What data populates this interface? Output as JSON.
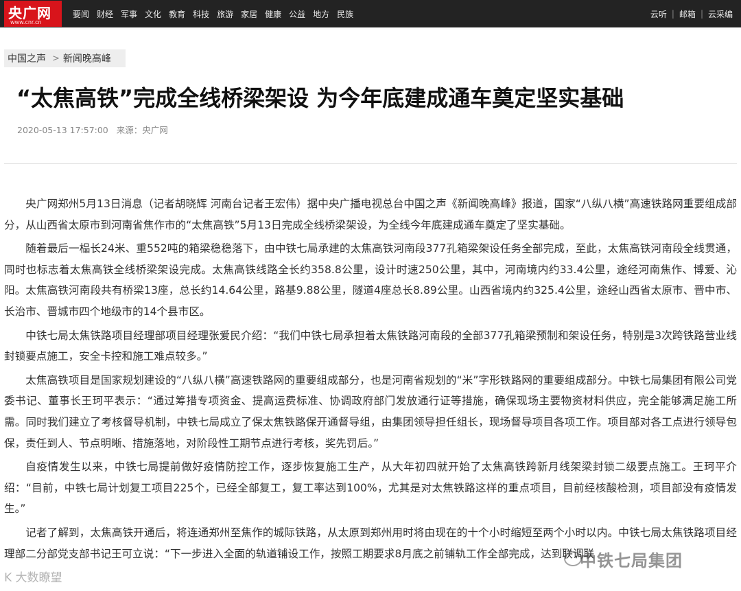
{
  "header": {
    "logo_cn": "央广网",
    "logo_en": "www.cnr.cn",
    "nav": [
      "要闻",
      "财经",
      "军事",
      "文化",
      "教育",
      "科技",
      "旅游",
      "家居",
      "健康",
      "公益",
      "地方",
      "民族"
    ],
    "right_nav": [
      "云听",
      "邮箱",
      "云采编"
    ]
  },
  "breadcrumb": {
    "first": "中国之声",
    "second": "新闻晚高峰"
  },
  "article": {
    "title": "“太焦高铁”完成全线桥梁架设 为今年底建成通车奠定坚实基础",
    "date": "2020-05-13 17:57:00",
    "source": "来源：央广网",
    "paragraphs": [
      "央广网郑州5月13日消息（记者胡晓辉 河南台记者王宏伟）据中央广播电视总台中国之声《新闻晚高峰》报道，国家“八纵八横”高速铁路网重要组成部分，从山西省太原市到河南省焦作市的“太焦高铁”5月13日完成全线桥梁架设，为全线今年底建成通车奠定了坚实基础。",
      "随着最后一榀长24米、重552吨的箱梁稳稳落下，由中铁七局承建的太焦高铁河南段377孔箱梁架设任务全部完成，至此，太焦高铁河南段全线贯通，同时也标志着太焦高铁全线桥梁架设完成。太焦高铁线路全长约358.8公里，设计时速250公里，其中，河南境内约33.4公里，途经河南焦作、博爱、沁阳。太焦高铁河南段共有桥梁13座，总长约14.64公里，路基9.88公里，隧道4座总长8.89公里。山西省境内约325.4公里，途经山西省太原市、晋中市、长治市、晋城市四个地级市的14个县市区。",
      "中铁七局太焦铁路项目经理部项目经理张爱民介绍：“我们中铁七局承担着太焦铁路河南段的全部377孔箱梁预制和架设任务，特别是3次跨铁路营业线封锁要点施工，安全卡控和施工难点较多。”",
      "太焦高铁项目是国家规划建设的“八纵八横”高速铁路网的重要组成部分，也是河南省规划的“米”字形铁路网的重要组成部分。中铁七局集团有限公司党委书记、董事长王珂平表示：“通过筹措专项资金、提高运费标准、协调政府部门发放通行证等措施，确保现场主要物资材料供应，完全能够满足施工所需。同时我们建立了考核督导机制，中铁七局成立了保太焦铁路保开通督导组，由集团领导担任组长，现场督导项目各项工作。项目部对各工点进行领导包保，责任到人、节点明晰、措施落地，对阶段性工期节点进行考核，奖先罚后。”",
      "自疫情发生以来，中铁七局提前做好疫情防控工作，逐步恢复施工生产，从大年初四就开始了太焦高铁跨新月线架梁封锁二级要点施工。王珂平介绍：“目前，中铁七局计划复工项目225个，已经全部复工，复工率达到100%，尤其是对太焦铁路这样的重点项目，目前经核酸检测，项目部没有疫情发生。”",
      "记者了解到，太焦高铁开通后，将连通郑州至焦作的城际铁路，从太原到郑州用时将由现在的十个小时缩短至两个小时以内。中铁七局太焦铁路项目经理部二分部党支部书记王可立说：“下一步进入全面的轨道铺设工作，按照工期要求8月底之前铺轨工作全部完成，达到联调联"
    ]
  },
  "watermarks": {
    "right": "中铁七局集团",
    "left": "K 大数瞭望"
  }
}
